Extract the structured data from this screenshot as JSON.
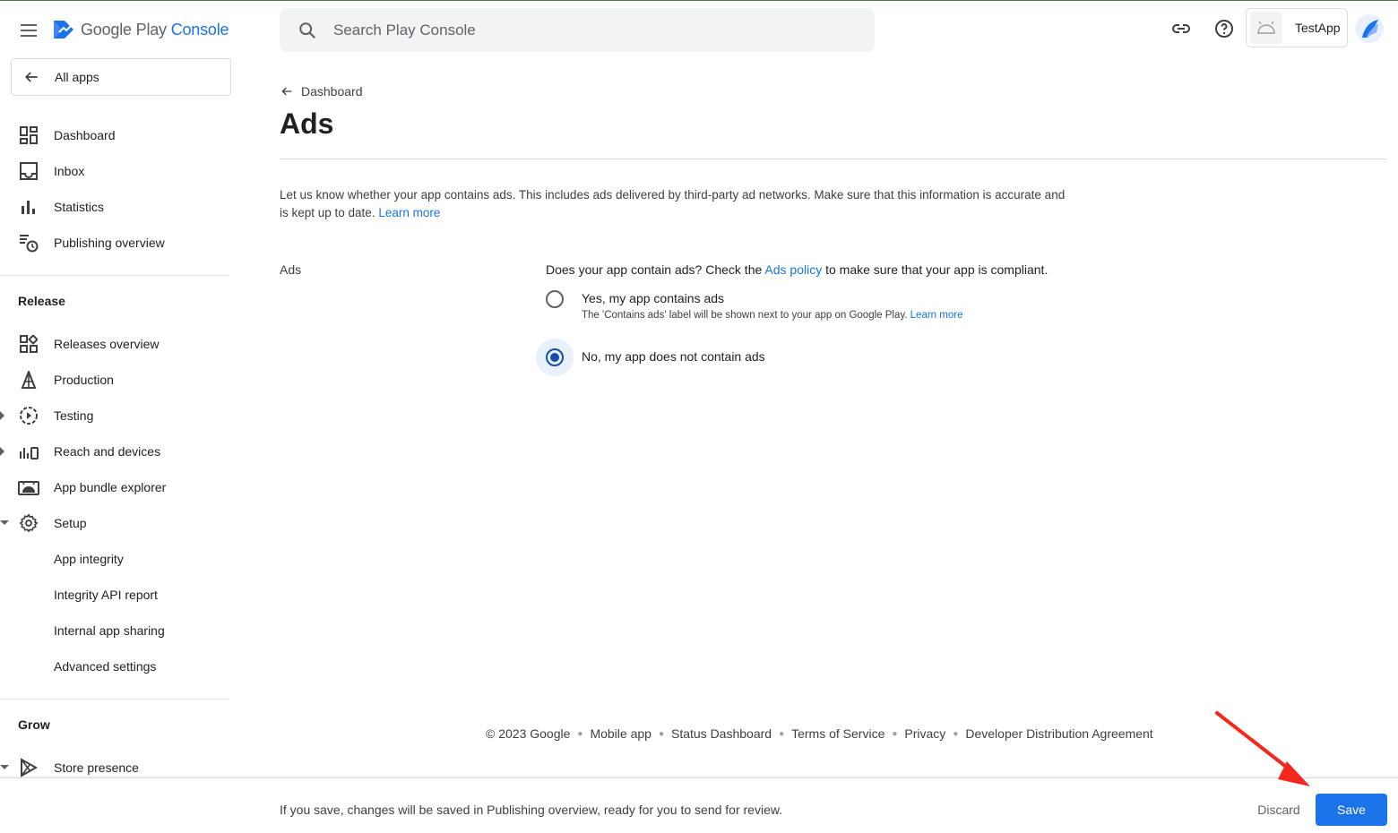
{
  "colors": {
    "accent": "#1a73e8",
    "selected_radio": "#174ea6",
    "annotation_arrow": "#f4281c"
  },
  "header": {
    "logo_text_main": "Google Play",
    "logo_text_accent": "Console",
    "search_placeholder": "Search Play Console",
    "app_name": "TestApp"
  },
  "sidebar": {
    "all_apps_label": "All apps",
    "top_items": [
      {
        "label": "Dashboard",
        "icon": "dashboard-icon"
      },
      {
        "label": "Inbox",
        "icon": "inbox-icon"
      },
      {
        "label": "Statistics",
        "icon": "bar-chart-icon"
      },
      {
        "label": "Publishing overview",
        "icon": "publishing-overview-icon"
      }
    ],
    "release_heading": "Release",
    "release_items": [
      {
        "label": "Releases overview",
        "icon": "releases-overview-icon"
      },
      {
        "label": "Production",
        "icon": "production-icon"
      },
      {
        "label": "Testing",
        "icon": "testing-icon"
      },
      {
        "label": "Reach and devices",
        "icon": "reach-devices-icon"
      },
      {
        "label": "App bundle explorer",
        "icon": "android-icon"
      },
      {
        "label": "Setup",
        "icon": "gear-icon"
      }
    ],
    "setup_subitems": [
      {
        "label": "App integrity"
      },
      {
        "label": "Integrity API report"
      },
      {
        "label": "Internal app sharing"
      },
      {
        "label": "Advanced settings"
      }
    ],
    "grow_heading": "Grow",
    "grow_items": [
      {
        "label": "Store presence",
        "icon": "store-presence-icon"
      }
    ]
  },
  "main": {
    "back_label": "Dashboard",
    "title": "Ads",
    "intro_text": "Let us know whether your app contains ads. This includes ads delivered by third-party ad networks. Make sure that this information is accurate and is kept up to date.",
    "intro_link": "Learn more",
    "field_label": "Ads",
    "question_prefix": "Does your app contain ads? Check the",
    "question_link": "Ads policy",
    "question_suffix": "to make sure that your app is compliant.",
    "options": [
      {
        "label": "Yes, my app contains ads",
        "sub": "The 'Contains ads' label will be shown next to your app on Google Play.",
        "sub_link": "Learn more",
        "selected": false
      },
      {
        "label": "No, my app does not contain ads",
        "selected": true
      }
    ]
  },
  "footer": {
    "copyright": "© 2023 Google",
    "links": [
      "Mobile app",
      "Status Dashboard",
      "Terms of Service",
      "Privacy",
      "Developer Distribution Agreement"
    ]
  },
  "savebar": {
    "message": "If you save, changes will be saved in Publishing overview, ready for you to send for review.",
    "discard_label": "Discard",
    "save_label": "Save"
  }
}
